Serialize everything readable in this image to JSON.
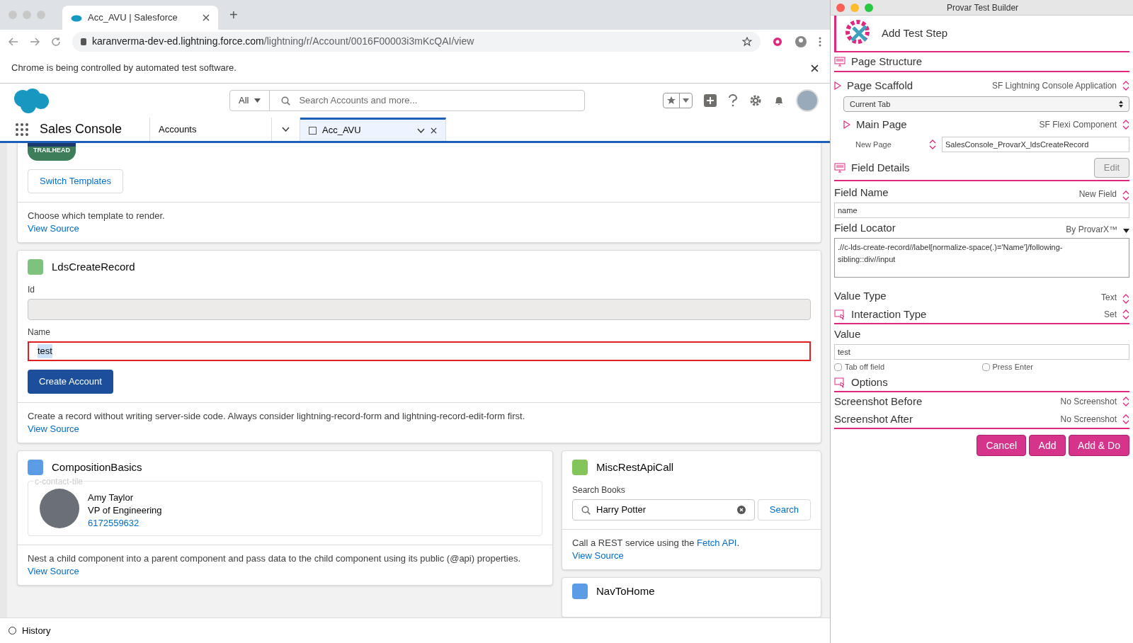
{
  "browser": {
    "tab_title": "Acc_AVU | Salesforce",
    "new_tab": "+",
    "url_host": "karanverma-dev-ed.lightning.force.com",
    "url_path": "/lightning/r/Account/0016F00003i3mKcQAI/view",
    "infobar": "Chrome is being controlled by automated test software."
  },
  "salesforce": {
    "search_scope": "All",
    "search_placeholder": "Search Accounts and more...",
    "app_name": "Sales Console",
    "tabs": [
      {
        "label": "Accounts",
        "selected": false
      },
      {
        "label": "Acc_AVU",
        "selected": true
      }
    ],
    "trailhead": "TRAILHEAD",
    "templates_card": {
      "button": "Switch Templates",
      "description": "Choose which template to render.",
      "link": "View Source"
    },
    "create_card": {
      "title": "LdsCreateRecord",
      "id_label": "Id",
      "name_label": "Name",
      "name_value": "test",
      "name_highlighted": true,
      "button": "Create Account",
      "description": "Create a record without writing server-side code. Always consider lightning-record-form and lightning-record-edit-form first.",
      "link": "View Source"
    },
    "composition_card": {
      "title": "CompositionBasics",
      "tile_label": "c-contact-tile",
      "contact_name": "Amy Taylor",
      "contact_title": "VP of Engineering",
      "contact_phone": "6172559632",
      "description": "Nest a child component into a parent component and pass data to the child component using its public (@api) properties.",
      "link": "View Source"
    },
    "rest_card": {
      "title": "MiscRestApiCall",
      "search_label": "Search Books",
      "search_value": "Harry Potter",
      "button": "Search",
      "description": "Call a REST service using the",
      "description_link": "Fetch API",
      "description_end": ".",
      "link": "View Source"
    },
    "nav_card": {
      "title": "NavToHome"
    },
    "history": "History"
  },
  "provar": {
    "window_title": "Provar Test Builder",
    "heading": "Add Test Step",
    "page_structure": "Page Structure",
    "page_scaffold": {
      "label": "Page Scaffold",
      "value": "SF Lightning Console Application",
      "select": "Current Tab"
    },
    "main_page": {
      "label": "Main Page",
      "value": "SF Flexi Component",
      "new_page_label": "New Page",
      "new_page_value": "SalesConsole_ProvarX_ldsCreateRecord"
    },
    "field_details": "Field Details",
    "edit_button": "Edit",
    "field_name": {
      "label": "Field Name",
      "value": "New Field",
      "input": "name"
    },
    "field_locator": {
      "label": "Field Locator",
      "value": "By ProvarX™",
      "input": ".//c-lds-create-record//label[normalize-space(.)='Name']/following-sibling::div//input"
    },
    "value_type": {
      "label": "Value Type",
      "value": "Text"
    },
    "interaction_type": {
      "label": "Interaction Type",
      "value": "Set"
    },
    "value": {
      "label": "Value",
      "input": "test"
    },
    "checkboxes": [
      {
        "label": "Tab off field",
        "checked": false
      },
      {
        "label": "Press Enter",
        "checked": false
      }
    ],
    "options": "Options",
    "screenshots": [
      {
        "label": "Screenshot Before",
        "value": "No Screenshot"
      },
      {
        "label": "Screenshot After",
        "value": "No Screenshot"
      }
    ],
    "buttons": [
      "Cancel",
      "Add",
      "Add & Do"
    ]
  }
}
